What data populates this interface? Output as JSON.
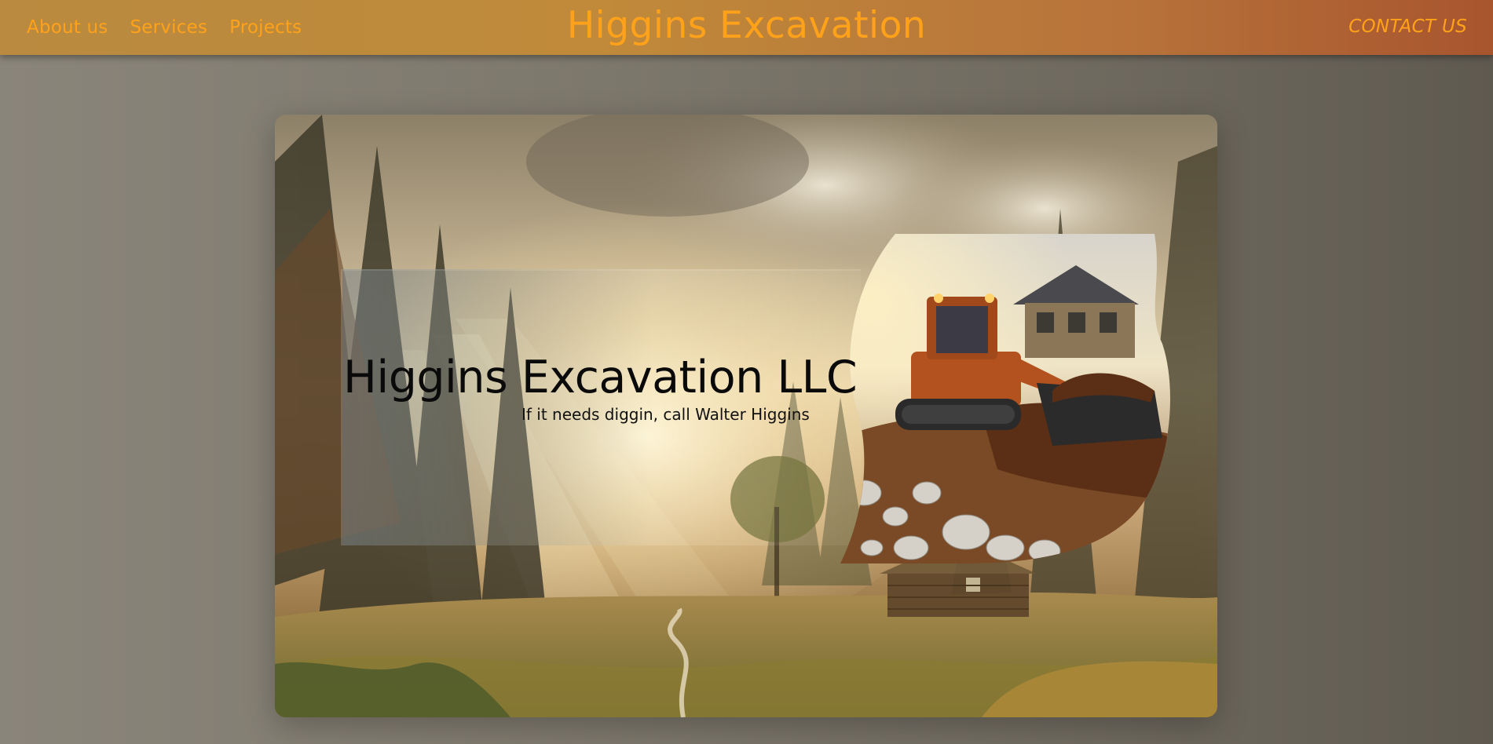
{
  "header": {
    "nav": {
      "about": "About us",
      "services": "Services",
      "projects": "Projects"
    },
    "brand": "Higgins Excavation",
    "contact": "CONTACT US"
  },
  "hero": {
    "title": "Higgins Excavation LLC",
    "subtitle": "If it needs diggin, call Walter Higgins"
  },
  "colors": {
    "accent": "#ffa21a",
    "header_start": "#b98a3f",
    "header_end": "#a8552e",
    "page_background": "#7d786c"
  }
}
